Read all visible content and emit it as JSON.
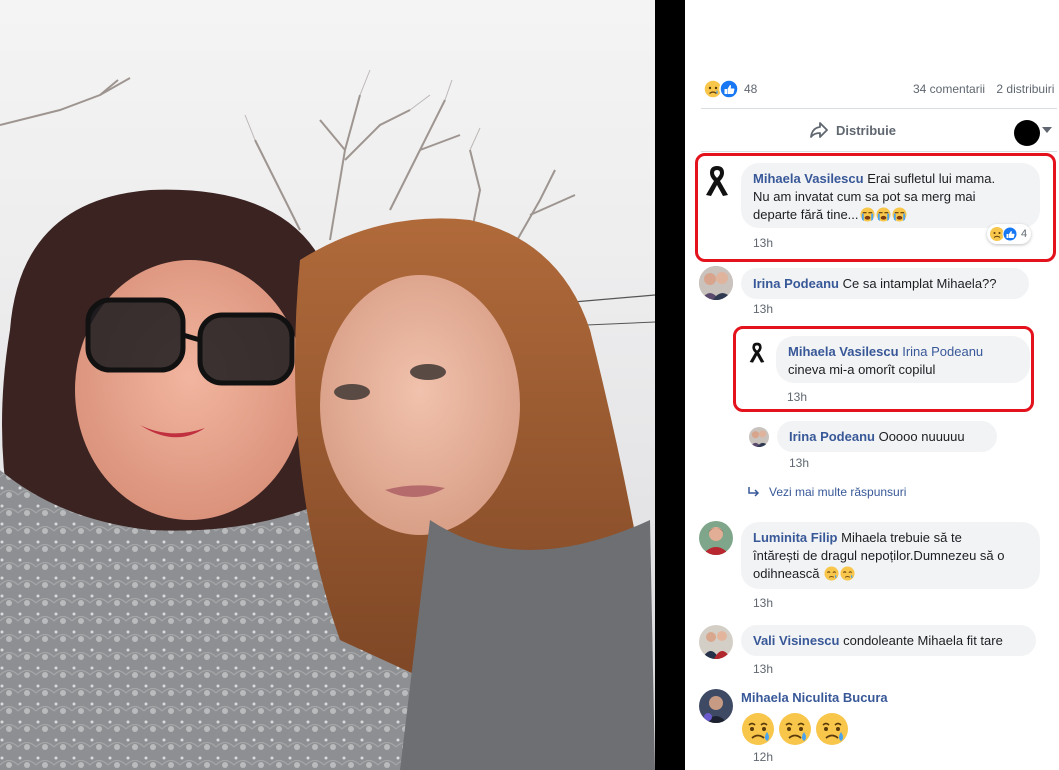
{
  "post": {
    "reaction_count": "48",
    "comments_count": "34 comentarii",
    "shares_count": "2 distribuiri",
    "share_label": "Distribuie"
  },
  "comments": [
    {
      "author": "Mihaela Vasilescu",
      "line1": "Erai sufletul lui mama.",
      "line2": "Nu am invatat cum sa pot sa merg mai",
      "line3": "departe fără tine...",
      "time": "13h",
      "reactions": "4"
    },
    {
      "author": "Irina Podeanu",
      "text": "Ce sa intamplat Mihaela??",
      "time": "13h"
    },
    {
      "author": "Mihaela Vasilescu",
      "mention": "Irina Podeanu",
      "line2": "cineva mi-a omorît copilul",
      "time": "13h"
    },
    {
      "author": "Irina Podeanu",
      "text": "Ooooo nuuuuu",
      "time": "13h"
    },
    {
      "more": "Vezi mai multe răspunsuri"
    },
    {
      "author": "Luminita Filip",
      "line1": "Mihaela trebuie să te",
      "line2": "întărești de dragul nepoților.Dumnezeu să o",
      "line3": "odihnească",
      "time": "13h"
    },
    {
      "author": "Vali Visinescu",
      "text": "condoleante Mihaela fit tare",
      "time": "13h"
    },
    {
      "author": "Mihaela Niculita Bucura",
      "time": "12h"
    }
  ],
  "icons": {
    "sad": "sad-reaction-icon",
    "like": "like-reaction-icon",
    "share": "share-arrow-icon",
    "cry": "crying-emoji-icon",
    "reply": "reply-arrow-icon"
  },
  "colors": {
    "link": "#385898",
    "bubble": "#f2f3f5",
    "highlight": "#e3121c"
  }
}
